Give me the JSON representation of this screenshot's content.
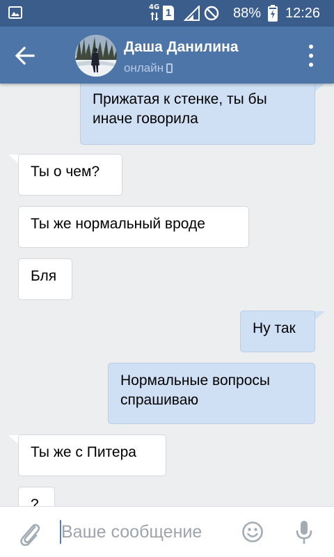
{
  "status_bar": {
    "network": "4G",
    "sim": "1",
    "battery_percent": "88%",
    "time": "12:26",
    "icons": [
      "gallery-icon",
      "network-arrows-icon",
      "sim-icon",
      "signal-icon",
      "do-not-disturb-icon",
      "battery-charging-icon"
    ]
  },
  "header": {
    "contact_name": "Даша Данилина",
    "contact_status": "онлайн",
    "icons": [
      "back-arrow-icon",
      "avatar",
      "mobile-device-icon",
      "more-vertical-icon"
    ]
  },
  "messages": [
    {
      "direction": "out",
      "lines": [
        "Прижатая к стенке, ты бы",
        "иначе говорила"
      ]
    },
    {
      "direction": "in",
      "lines": [
        "Ты о чем?"
      ]
    },
    {
      "direction": "in",
      "lines": [
        "Ты же нормальный вроде"
      ]
    },
    {
      "direction": "in",
      "lines": [
        "Бля"
      ]
    },
    {
      "direction": "out",
      "lines": [
        "Ну так"
      ]
    },
    {
      "direction": "out",
      "lines": [
        "Нормальные вопросы",
        "спрашиваю"
      ]
    },
    {
      "direction": "in",
      "lines": [
        "Ты же с Питера"
      ]
    },
    {
      "direction": "in",
      "lines": [
        "?"
      ]
    }
  ],
  "compose": {
    "placeholder": "Ваше сообщение",
    "value": "",
    "icons": [
      "paperclip-icon",
      "emoji-icon",
      "microphone-icon"
    ]
  },
  "colors": {
    "status_bar_bg": "#3b5d8c",
    "header_bg": "#4d75a8",
    "chat_bg": "#edeef0",
    "incoming_bubble": "#ffffff",
    "outgoing_bubble": "#cfe0f5",
    "accent": "#5181b8"
  }
}
